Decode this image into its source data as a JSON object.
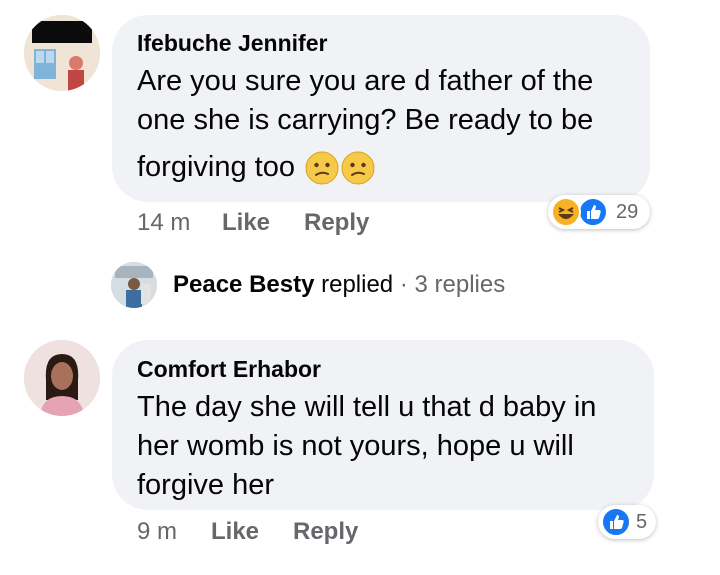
{
  "comments": [
    {
      "author": "Ifebuche Jennifer",
      "lines": [
        "Are you sure you are d father of the",
        "one she is carrying? Be ready to be",
        "forgiving too"
      ],
      "time": "14 m",
      "like_label": "Like",
      "reply_label": "Reply",
      "reaction_count": "29",
      "reaction_icons": [
        "laugh-icon",
        "like-icon"
      ],
      "emoji_icons": [
        "confused-face-icon",
        "confused-face-icon"
      ]
    },
    {
      "author": "Comfort Erhabor",
      "lines": [
        "The day she will tell u that d baby in",
        "her womb is not yours, hope u will",
        "forgive her"
      ],
      "time": "9 m",
      "like_label": "Like",
      "reply_label": "Reply",
      "reaction_count": "5",
      "reaction_icons": [
        "like-icon"
      ]
    }
  ],
  "reply_summary": {
    "name": "Peace Besty",
    "action": "replied",
    "separator": "·",
    "count_text": "3 replies"
  },
  "colors": {
    "bubble": "#f0f2f5",
    "meta": "#65676b",
    "like_blue": "#1877f2",
    "laugh_yellow": "#f7b125"
  }
}
